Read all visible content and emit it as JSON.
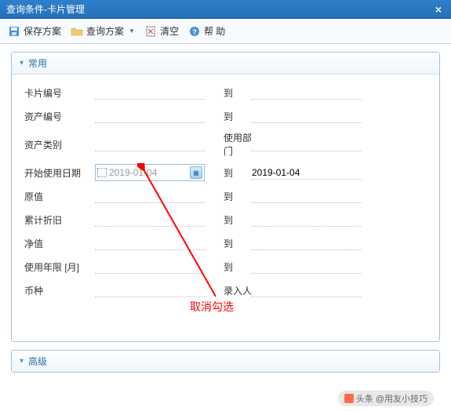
{
  "titlebar": {
    "title": "查询条件-卡片管理"
  },
  "toolbar": {
    "save_label": "保存方案",
    "query_label": "查询方案",
    "clear_label": "清空",
    "help_label": "帮 助"
  },
  "panels": {
    "common": {
      "title": "常用",
      "rows": [
        {
          "label_left": "卡片编号",
          "label_mid": "到"
        },
        {
          "label_left": "资产编号",
          "label_mid": "到"
        },
        {
          "label_left": "资产类别",
          "label_mid": "使用部门"
        },
        {
          "label_left": "开始使用日期",
          "date_value": "2019-01-04",
          "label_mid": "到",
          "value_right": "2019-01-04"
        },
        {
          "label_left": "原值",
          "label_mid": "到"
        },
        {
          "label_left": "累计折旧",
          "label_mid": "到"
        },
        {
          "label_left": "净值",
          "label_mid": "到"
        },
        {
          "label_left": "使用年限 [月]",
          "label_mid": "到"
        },
        {
          "label_left": "币种",
          "label_mid": "录入人"
        }
      ]
    },
    "advanced": {
      "title": "高级"
    }
  },
  "annotation": {
    "text": "取消勾选"
  },
  "footer": {
    "badge_prefix": "头条",
    "badge_text": "@用友小技巧"
  }
}
